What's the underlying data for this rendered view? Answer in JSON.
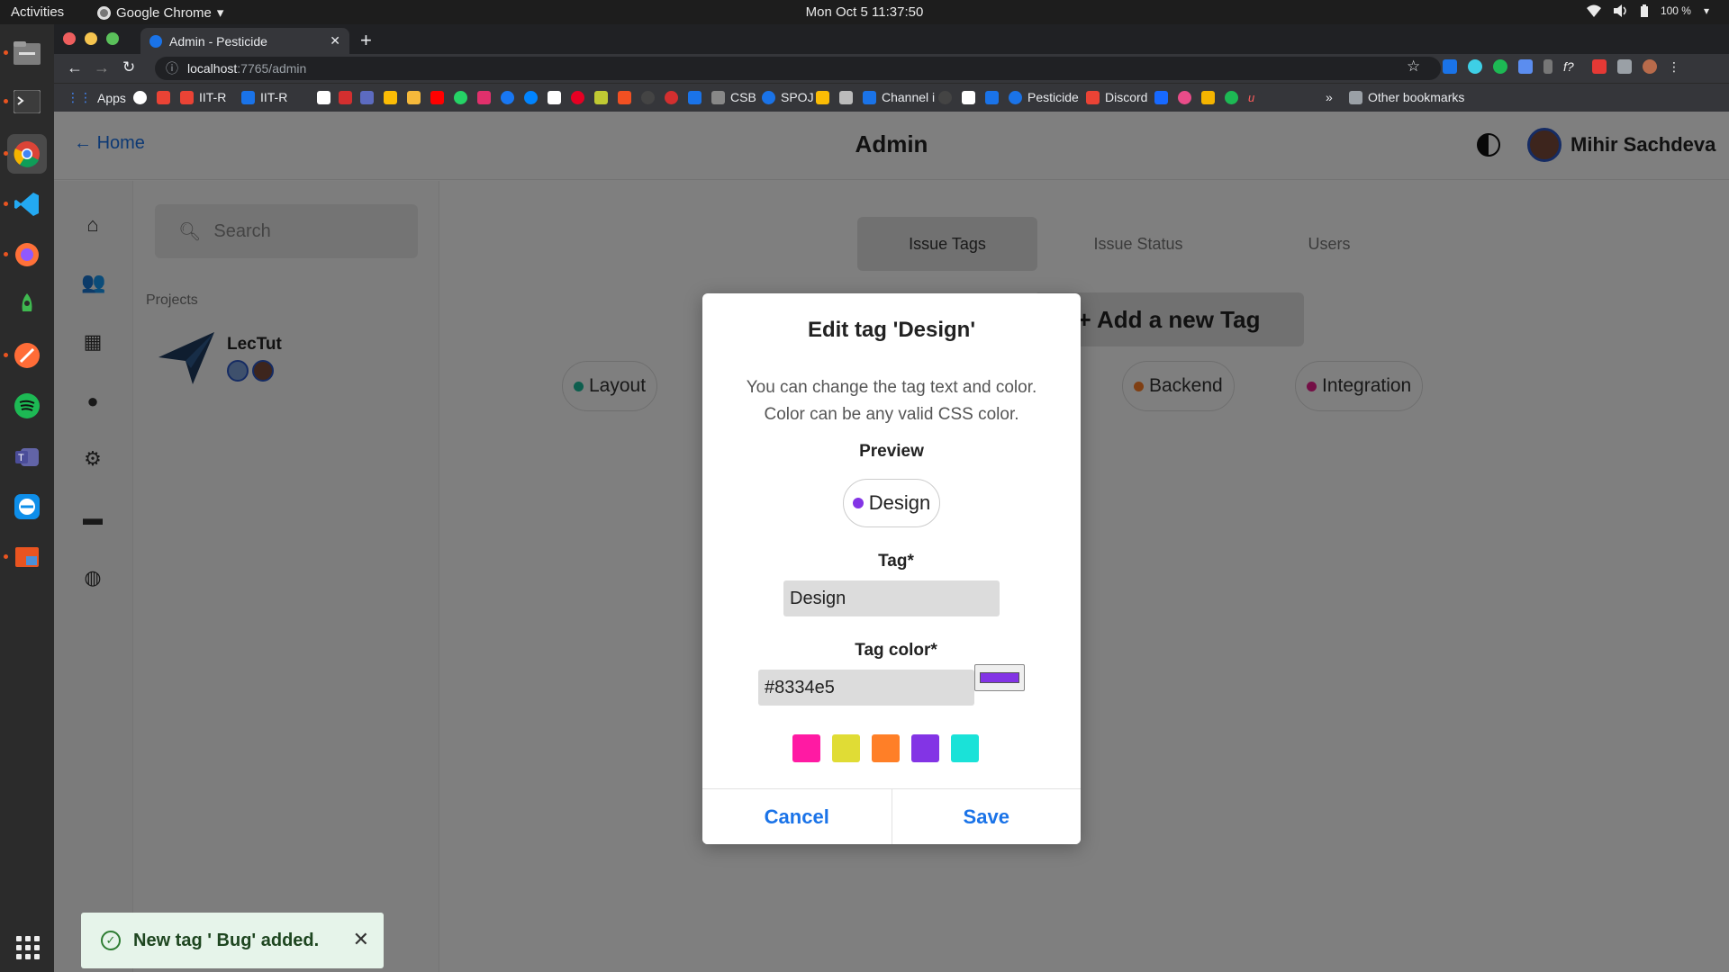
{
  "system": {
    "activities": "Activities",
    "app_name": "Google Chrome",
    "clock": "Mon Oct 5  11:37:50",
    "battery": "100 %"
  },
  "browser": {
    "tab_title": "Admin - Pesticide",
    "url_host": "localhost",
    "url_rest": ":7765/admin",
    "bookmarks": [
      {
        "label": "Apps",
        "color": "#4285f4"
      },
      {
        "label": "IIT-R",
        "color": "#ea4335"
      },
      {
        "label": "IIT-R",
        "color": "#1a73e8"
      },
      {
        "label": "CSB",
        "color": "#888888"
      },
      {
        "label": "SPOJ",
        "color": "#1a73e8"
      },
      {
        "label": "Channel i",
        "color": "#1a73e8"
      },
      {
        "label": "Pesticide",
        "color": "#1a73e8"
      },
      {
        "label": "Discord",
        "color": "#ea4335"
      }
    ],
    "other_bookmarks": "Other bookmarks"
  },
  "header": {
    "home": "Home",
    "title": "Admin",
    "user_name": "Mihir Sachdeva"
  },
  "sidebar": {
    "search_placeholder": "Search",
    "projects_heading": "Projects",
    "project_name": "LecTut"
  },
  "main": {
    "tabs": [
      "Issue Tags",
      "Issue Status",
      "Users"
    ],
    "new_tag_button": "+ Add a new Tag",
    "tags": [
      {
        "label": "Layout",
        "color": "#1abc9c"
      },
      {
        "label": "Backend",
        "color": "#ff7f27"
      },
      {
        "label": "Integration",
        "color": "#e91e8c"
      }
    ]
  },
  "modal": {
    "title": "Edit tag 'Design'",
    "description_line1": "You can change the tag text and color.",
    "description_line2": "Color can be any valid CSS color.",
    "preview_label": "Preview",
    "preview_tag": "Design",
    "tag_label": "Tag*",
    "tag_value": "Design",
    "color_label": "Tag color*",
    "color_value": "#8334e5",
    "swatches": [
      "#ff1aa3",
      "#e0dc35",
      "#ff7f27",
      "#8334e5",
      "#1ae2d8"
    ],
    "cancel": "Cancel",
    "save": "Save"
  },
  "toast": {
    "message": "New tag ' Bug' added."
  }
}
